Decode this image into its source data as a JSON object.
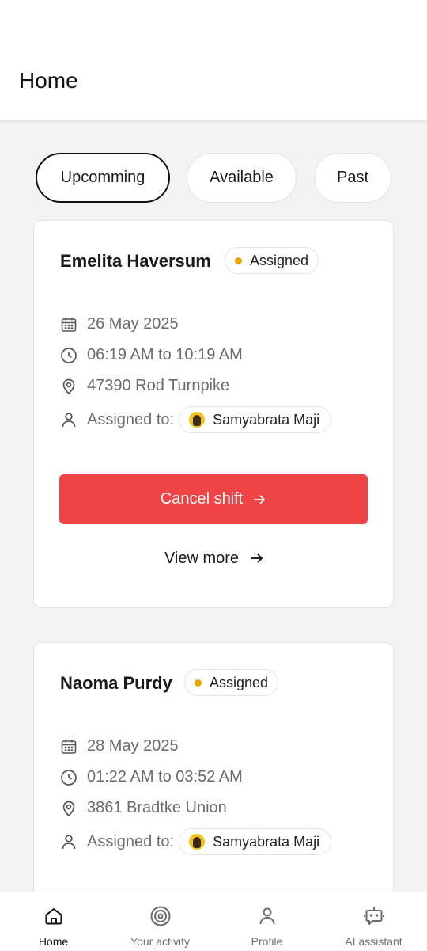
{
  "header": {
    "title": "Home"
  },
  "tabs": [
    {
      "label": "Upcomming",
      "active": true
    },
    {
      "label": "Available",
      "active": false
    },
    {
      "label": "Past",
      "active": false
    }
  ],
  "shifts": [
    {
      "name": "Emelita Haversum",
      "status": "Assigned",
      "date": "26 May 2025",
      "time": "06:19 AM to 10:19 AM",
      "address": "47390 Rod Turnpike",
      "assigned_label": "Assigned to:",
      "assignee": "Samyabrata Maji",
      "cancel_label": "Cancel shift",
      "view_more_label": "View more"
    },
    {
      "name": "Naoma Purdy",
      "status": "Assigned",
      "date": "28 May 2025",
      "time": "01:22 AM to 03:52 AM",
      "address": "3861 Bradtke Union",
      "assigned_label": "Assigned to:",
      "assignee": "Samyabrata Maji"
    }
  ],
  "nav": [
    {
      "label": "Home",
      "icon": "home-icon",
      "active": true
    },
    {
      "label": "Your activity",
      "icon": "target-icon",
      "active": false
    },
    {
      "label": "Profile",
      "icon": "user-icon",
      "active": false
    },
    {
      "label": "AI assistant",
      "icon": "robot-icon",
      "active": false
    }
  ],
  "colors": {
    "cancel": "#ef4446",
    "status_dot": "#f0a400",
    "background": "#f3f3f3"
  }
}
